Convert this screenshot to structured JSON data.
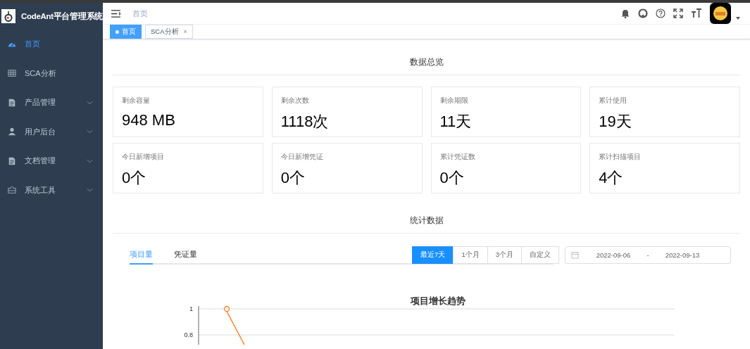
{
  "sidebar": {
    "title": "CodeAnt平台管理系统",
    "items": [
      {
        "label": "首页",
        "selected": true,
        "expandable": false
      },
      {
        "label": "SCA分析",
        "selected": false,
        "expandable": false
      },
      {
        "label": "产品管理",
        "selected": false,
        "expandable": true
      },
      {
        "label": "用户后台",
        "selected": false,
        "expandable": true
      },
      {
        "label": "文档管理",
        "selected": false,
        "expandable": true
      },
      {
        "label": "系统工具",
        "selected": false,
        "expandable": true
      }
    ]
  },
  "header": {
    "breadcrumb": "首页"
  },
  "tags": [
    {
      "label": "首页",
      "selected": true,
      "closable": false
    },
    {
      "label": "SCA分析",
      "selected": false,
      "closable": true,
      "close": "×"
    }
  ],
  "overview": {
    "title": "数据总览",
    "cards": [
      {
        "label": "剩余容量",
        "value": "948 MB"
      },
      {
        "label": "剩余次数",
        "value": "1118次"
      },
      {
        "label": "剩余期限",
        "value": "11天"
      },
      {
        "label": "累计使用",
        "value": "19天"
      },
      {
        "label": "今日新增项目",
        "value": "0个"
      },
      {
        "label": "今日新增凭证",
        "value": "0个"
      },
      {
        "label": "累计凭证数",
        "value": "0个"
      },
      {
        "label": "累计扫描项目",
        "value": "4个"
      }
    ]
  },
  "stats": {
    "title": "统计数据",
    "tabs": [
      {
        "label": "项目量",
        "selected": true
      },
      {
        "label": "凭证量",
        "selected": false
      }
    ],
    "ranges": [
      {
        "label": "最近7天",
        "selected": true
      },
      {
        "label": "1个月",
        "selected": false
      },
      {
        "label": "3个月",
        "selected": false
      },
      {
        "label": "自定义",
        "selected": false
      }
    ],
    "date_start": "2022-09-06",
    "date_separator": "-",
    "date_end": "2022-09-13",
    "chart": {
      "title": "项目增长趋势",
      "tick_labels": [
        "1",
        "0.8"
      ]
    }
  }
}
